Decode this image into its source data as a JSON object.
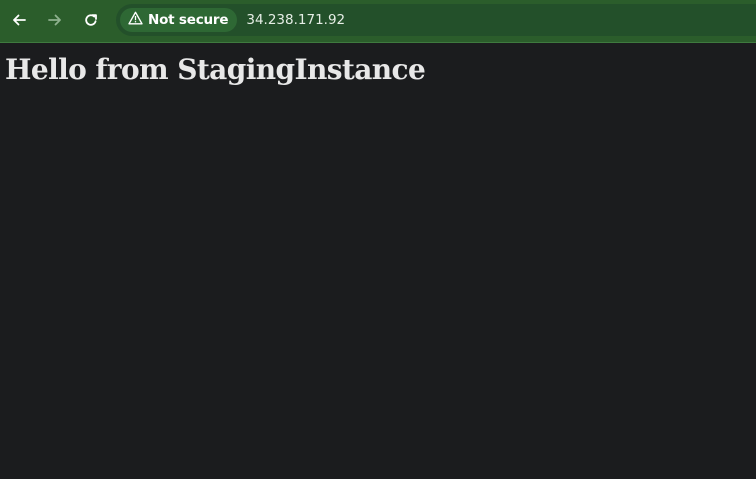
{
  "browser": {
    "nav": {
      "back_icon": "arrow-left-icon",
      "forward_icon": "arrow-right-icon",
      "reload_icon": "reload-icon"
    },
    "omnibox": {
      "security_icon": "warning-triangle-icon",
      "security_label": "Not secure",
      "url": "34.238.171.92"
    },
    "colors": {
      "toolbar": "#2b5d2b",
      "omnibox": "#23502a",
      "page_background": "#1b1c1e",
      "heading_text": "#e8e8e8"
    }
  },
  "page": {
    "heading": "Hello from StagingInstance"
  }
}
